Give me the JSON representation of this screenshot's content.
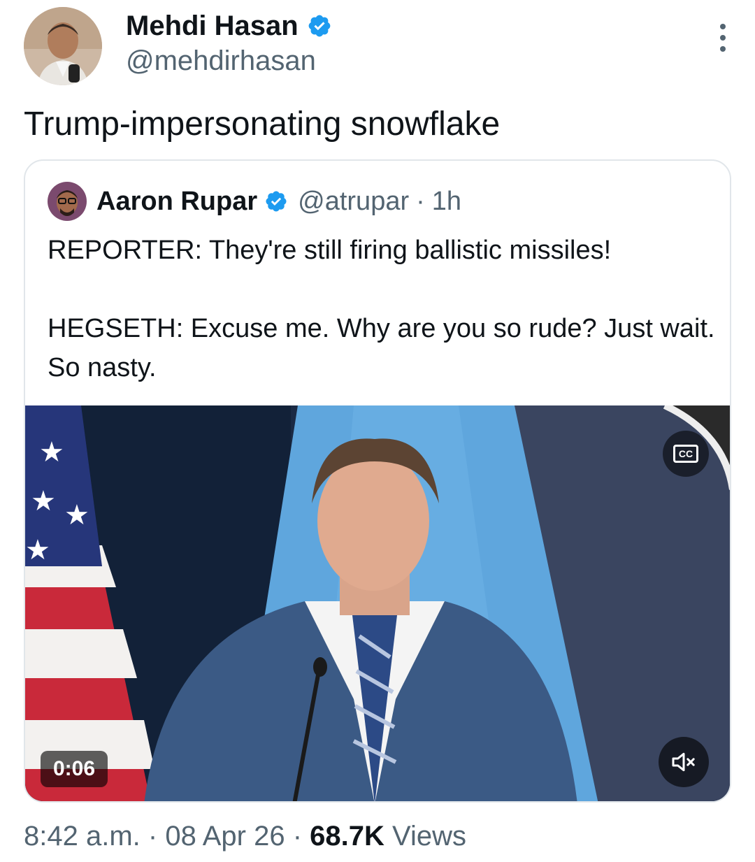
{
  "tweet": {
    "author_name": "Mehdi Hasan",
    "author_handle": "@mehdirhasan",
    "text": "Trump-impersonating snowflake",
    "time": "8:42 a.m.",
    "separator": "·",
    "date": "08 Apr 26",
    "views_count": "68.7K",
    "views_label": "Views"
  },
  "quoted_tweet": {
    "author_name": "Aaron Rupar",
    "author_handle": "@atrupar",
    "separator": "·",
    "time_ago": "1h",
    "text": "REPORTER: They're still firing ballistic missiles!\n\nHEGSETH: Excuse me. Why are you so rude? Just wait. So nasty."
  },
  "video": {
    "duration": "0:06",
    "cc_label": "CC"
  },
  "colors": {
    "verified": "#1d9bf0",
    "text_primary": "#0f1419",
    "text_secondary": "#536471",
    "border": "#e1e6ea"
  },
  "icons": [
    "verified-badge-icon",
    "more-options-icon",
    "closed-captions-icon",
    "mute-icon"
  ]
}
